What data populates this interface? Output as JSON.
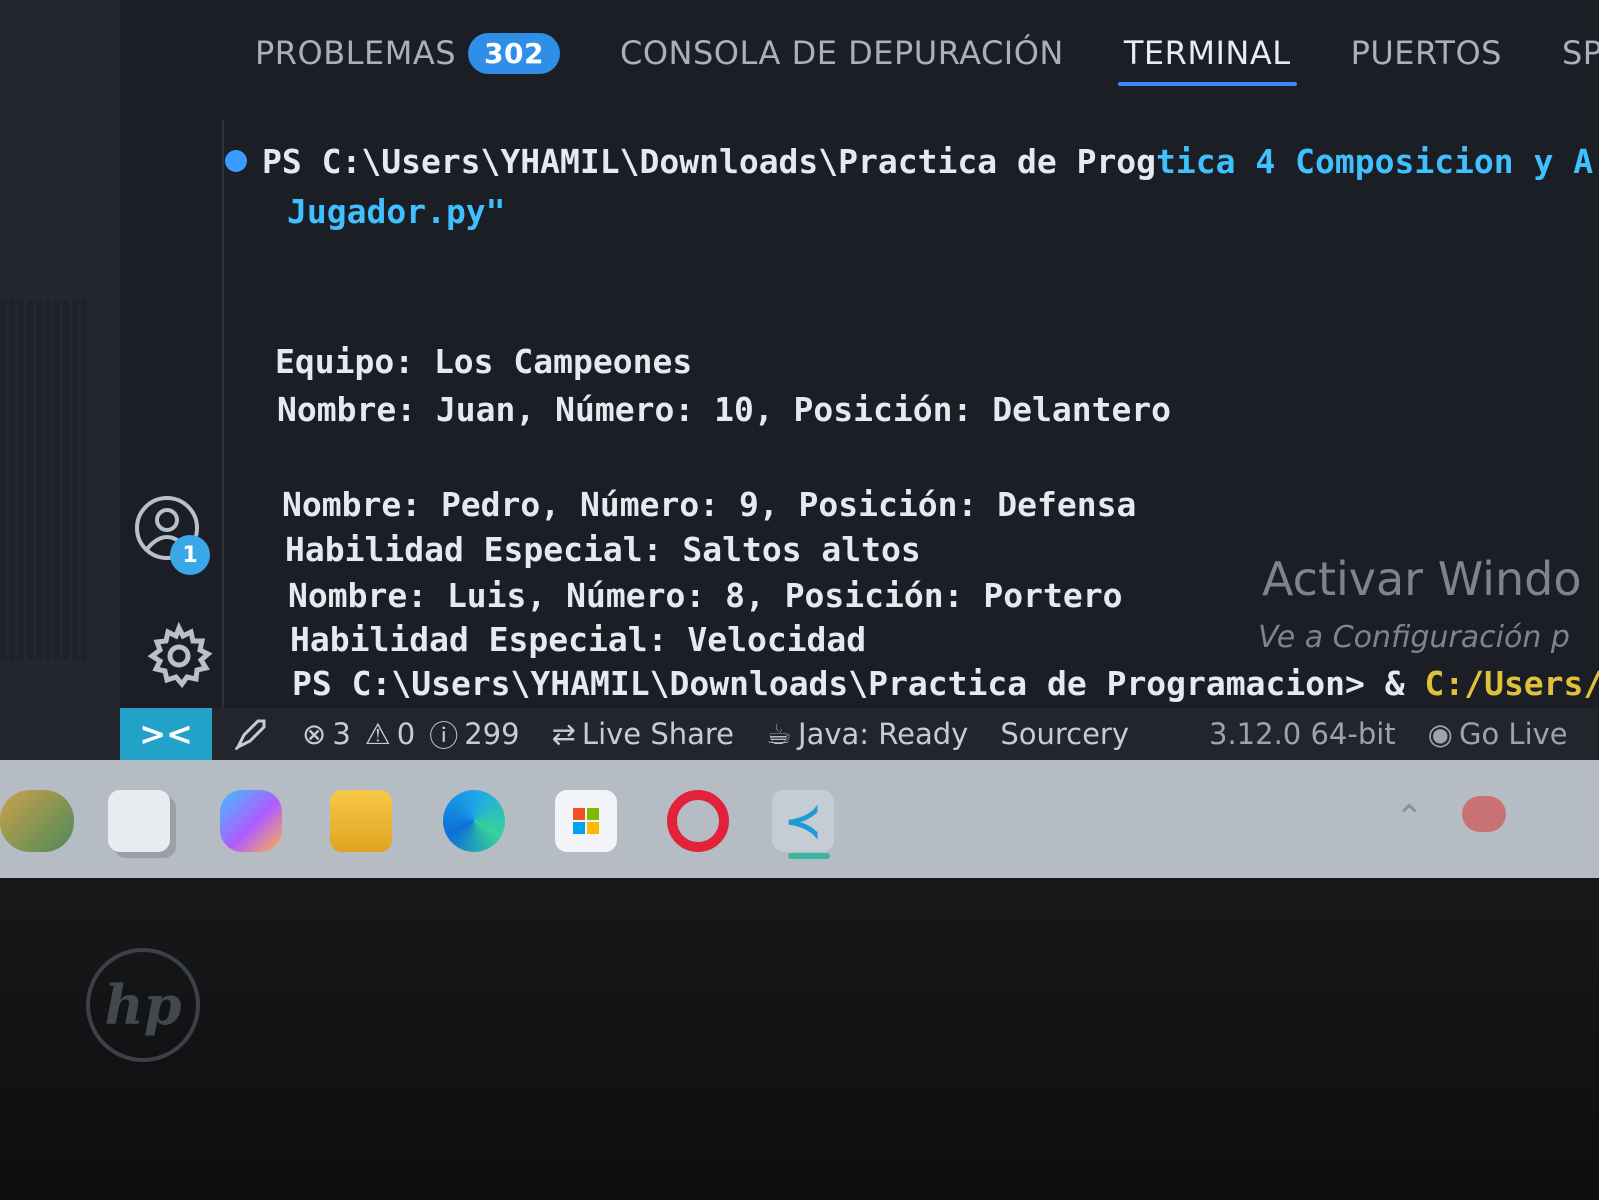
{
  "panel": {
    "tabs": [
      {
        "label": "PROBLEMAS",
        "badge": "302"
      },
      {
        "label": "CONSOLA DE DEPURACIÓN"
      },
      {
        "label": "TERMINAL"
      },
      {
        "label": "PUERTOS"
      },
      {
        "label": "SPELL CHEC"
      }
    ],
    "active_tab": "TERMINAL"
  },
  "activity": {
    "more": "•••",
    "account_badge": "1"
  },
  "terminal": {
    "lines": [
      "PS C:\\Users\\YHAMIL\\Downloads\\Practica de Prog",
      "tica 4 Composicion y A",
      "Jugador.py\"",
      "Equipo: Los Campeones",
      "Nombre: Juan, Número: 10, Posición: Delantero",
      "Nombre: Pedro, Número: 9, Posición: Defensa",
      "Habilidad Especial: Saltos altos",
      "Nombre: Luis, Número: 8, Posición: Portero",
      "Habilidad Especial: Velocidad",
      "PS C:\\Users\\YHAMIL\\Downloads\\Practica de Programacion> & ",
      "C:/Users/YHAMI"
    ]
  },
  "watermark": {
    "title": "Activar Windo",
    "subtitle": "Ve a Configuración p"
  },
  "status_bar": {
    "errors": "3",
    "warnings": "0",
    "info": "299",
    "live_share": "Live Share",
    "java": "Java: Ready",
    "sourcery": "Sourcery",
    "python_version": "3.12.0 64-bit",
    "go_live": "Go Live"
  },
  "colors": {
    "accent": "#3a8bff",
    "badge": "#2f8fe8",
    "remote": "#22a2c8",
    "cyan_text": "#3fc1ff"
  },
  "taskbar": {
    "icons": [
      "widgets-icon",
      "task-view-icon",
      "copilot-icon",
      "file-explorer-icon",
      "edge-icon",
      "store-icon",
      "opera-icon",
      "vscode-icon"
    ]
  },
  "device": {
    "logo": "hp"
  }
}
